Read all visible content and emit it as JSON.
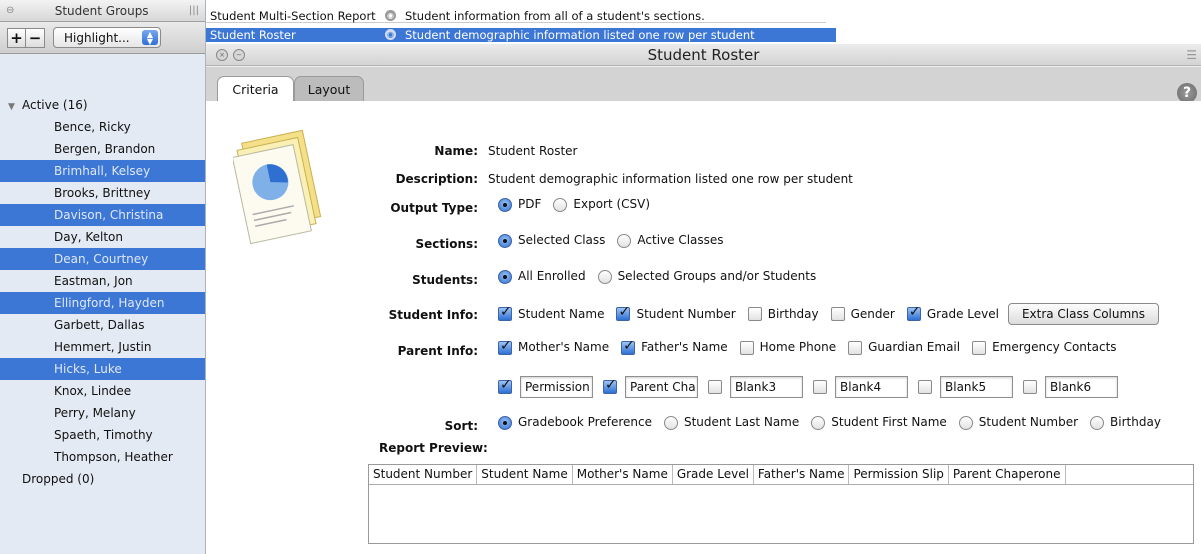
{
  "sidebar": {
    "header_title": "Student Groups",
    "add_label": "+",
    "remove_label": "−",
    "highlight_value": "Highlight...",
    "groups": [
      {
        "label": "Active (16)",
        "expanded": true
      },
      {
        "label": "Dropped (0)",
        "expanded": false
      }
    ],
    "students": [
      {
        "name": "Bence, Ricky",
        "selected": false
      },
      {
        "name": "Bergen, Brandon",
        "selected": false
      },
      {
        "name": "Brimhall, Kelsey",
        "selected": true
      },
      {
        "name": "Brooks, Brittney",
        "selected": false
      },
      {
        "name": "Davison, Christina",
        "selected": true
      },
      {
        "name": "Day, Kelton",
        "selected": false
      },
      {
        "name": "Dean, Courtney",
        "selected": true
      },
      {
        "name": "Eastman, Jon",
        "selected": false
      },
      {
        "name": "Ellingford, Hayden",
        "selected": true
      },
      {
        "name": "Garbett, Dallas",
        "selected": false
      },
      {
        "name": "Hemmert, Justin",
        "selected": false
      },
      {
        "name": "Hicks, Luke",
        "selected": true
      },
      {
        "name": "Knox, Lindee",
        "selected": false
      },
      {
        "name": "Perry, Melany",
        "selected": false
      },
      {
        "name": "Spaeth, Timothy",
        "selected": false
      },
      {
        "name": "Thompson, Heather",
        "selected": false
      }
    ]
  },
  "reports": [
    {
      "name": "Student Multi-Section Report",
      "description": "Student information from all of a student's sections."
    },
    {
      "name": "Student Roster",
      "description": "Student demographic information listed one row per student"
    }
  ],
  "window": {
    "title": "Student Roster",
    "tabs": [
      "Criteria",
      "Layout"
    ],
    "help_label": "?"
  },
  "form": {
    "name_label": "Name:",
    "name_value": "Student Roster",
    "description_label": "Description:",
    "description_value": "Student demographic information listed one row per student",
    "output_label": "Output Type:",
    "output_options": [
      {
        "label": "PDF",
        "on": true
      },
      {
        "label": "Export (CSV)",
        "on": false
      }
    ],
    "sections_label": "Sections:",
    "sections_options": [
      {
        "label": "Selected Class",
        "on": true
      },
      {
        "label": "Active Classes",
        "on": false
      }
    ],
    "students_label": "Students:",
    "students_options": [
      {
        "label": "All Enrolled",
        "on": true
      },
      {
        "label": "Selected Groups and/or Students",
        "on": false
      }
    ],
    "student_info_label": "Student Info:",
    "student_info_options": [
      {
        "label": "Student Name",
        "on": true
      },
      {
        "label": "Student Number",
        "on": true
      },
      {
        "label": "Birthday",
        "on": false
      },
      {
        "label": "Gender",
        "on": false
      },
      {
        "label": "Grade Level",
        "on": true
      }
    ],
    "extra_button": "Extra Class Columns",
    "parent_info_label": "Parent Info:",
    "parent_info_options": [
      {
        "label": "Mother's Name",
        "on": true
      },
      {
        "label": "Father's Name",
        "on": true
      },
      {
        "label": "Home Phone",
        "on": false
      },
      {
        "label": "Guardian Email",
        "on": false
      },
      {
        "label": "Emergency Contacts",
        "on": false
      }
    ],
    "custom_fields": [
      {
        "value": "Permission",
        "on": true
      },
      {
        "value": "Parent Cha",
        "on": true
      },
      {
        "value": "Blank3",
        "on": false
      },
      {
        "value": "Blank4",
        "on": false
      },
      {
        "value": "Blank5",
        "on": false
      },
      {
        "value": "Blank6",
        "on": false
      }
    ],
    "sort_label": "Sort:",
    "sort_options": [
      {
        "label": "Gradebook Preference",
        "on": true
      },
      {
        "label": "Student Last Name",
        "on": false
      },
      {
        "label": "Student First Name",
        "on": false
      },
      {
        "label": "Student Number",
        "on": false
      },
      {
        "label": "Birthday",
        "on": false
      }
    ],
    "preview_label": "Report Preview:",
    "preview_columns": [
      "Student Number",
      "Student Name",
      "Mother's Name",
      "Grade Level",
      "Father's Name",
      "Permission Slip",
      "Parent Chaperone"
    ]
  },
  "colors": {
    "selection": "#3d77d6"
  }
}
